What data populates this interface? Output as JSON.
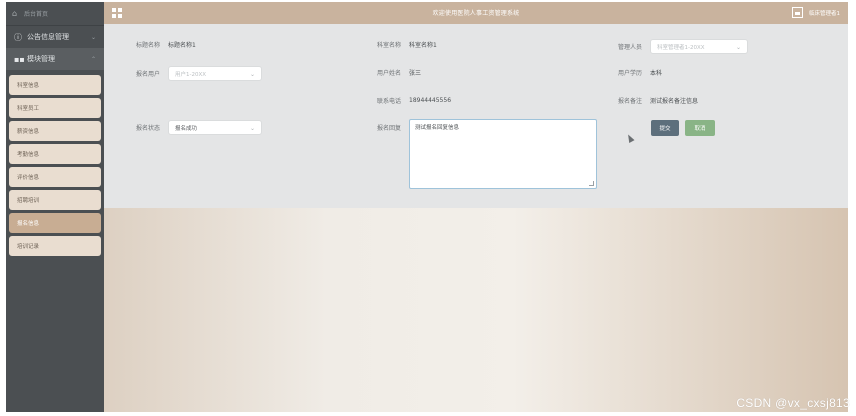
{
  "sidebar": {
    "brand_label": "后台首页",
    "groups": [
      {
        "label": "公告信息管理"
      },
      {
        "label": "模块管理"
      }
    ],
    "items": [
      {
        "label": "科室信息"
      },
      {
        "label": "科室员工"
      },
      {
        "label": "薪资信息"
      },
      {
        "label": "考勤信息"
      },
      {
        "label": "评价信息"
      },
      {
        "label": "招聘培训"
      },
      {
        "label": "报名信息"
      },
      {
        "label": "培训记录"
      }
    ]
  },
  "topbar": {
    "title": "欢迎使用医院人事工资管理系统",
    "user_label": "临床管理者1"
  },
  "form": {
    "title_label": "标题名称",
    "title_value": "标题名称1",
    "dept_label": "科室名称",
    "dept_value": "科室名称1",
    "manager_label": "管理人员",
    "manager_value": "科室管理者1-20XX",
    "signup_user_label": "报名用户",
    "signup_user_value": "用户1-20XX",
    "user_name_label": "用户姓名",
    "user_name_value": "张三",
    "edu_label": "用户学历",
    "edu_value": "本科",
    "phone_label": "联系电话",
    "phone_value": "18944445556",
    "note_label": "报名备注",
    "note_value": "测试报名备注信息",
    "status_label": "报名状态",
    "status_value": "报名成功",
    "reply_label": "报名回复",
    "reply_value": "测试报名回复信息",
    "submit_label": "提交",
    "cancel_label": "取消"
  },
  "watermark": "CSDN @vx_cxsj813",
  "colors": {
    "sidebar": "#4b4f52",
    "topbar": "#c9b39e",
    "panel": "#e4e5e6",
    "menu_item": "#e9ddd0",
    "menu_active": "#c8ad93",
    "submit": "#5d6f7c",
    "cancel": "#89b486"
  }
}
